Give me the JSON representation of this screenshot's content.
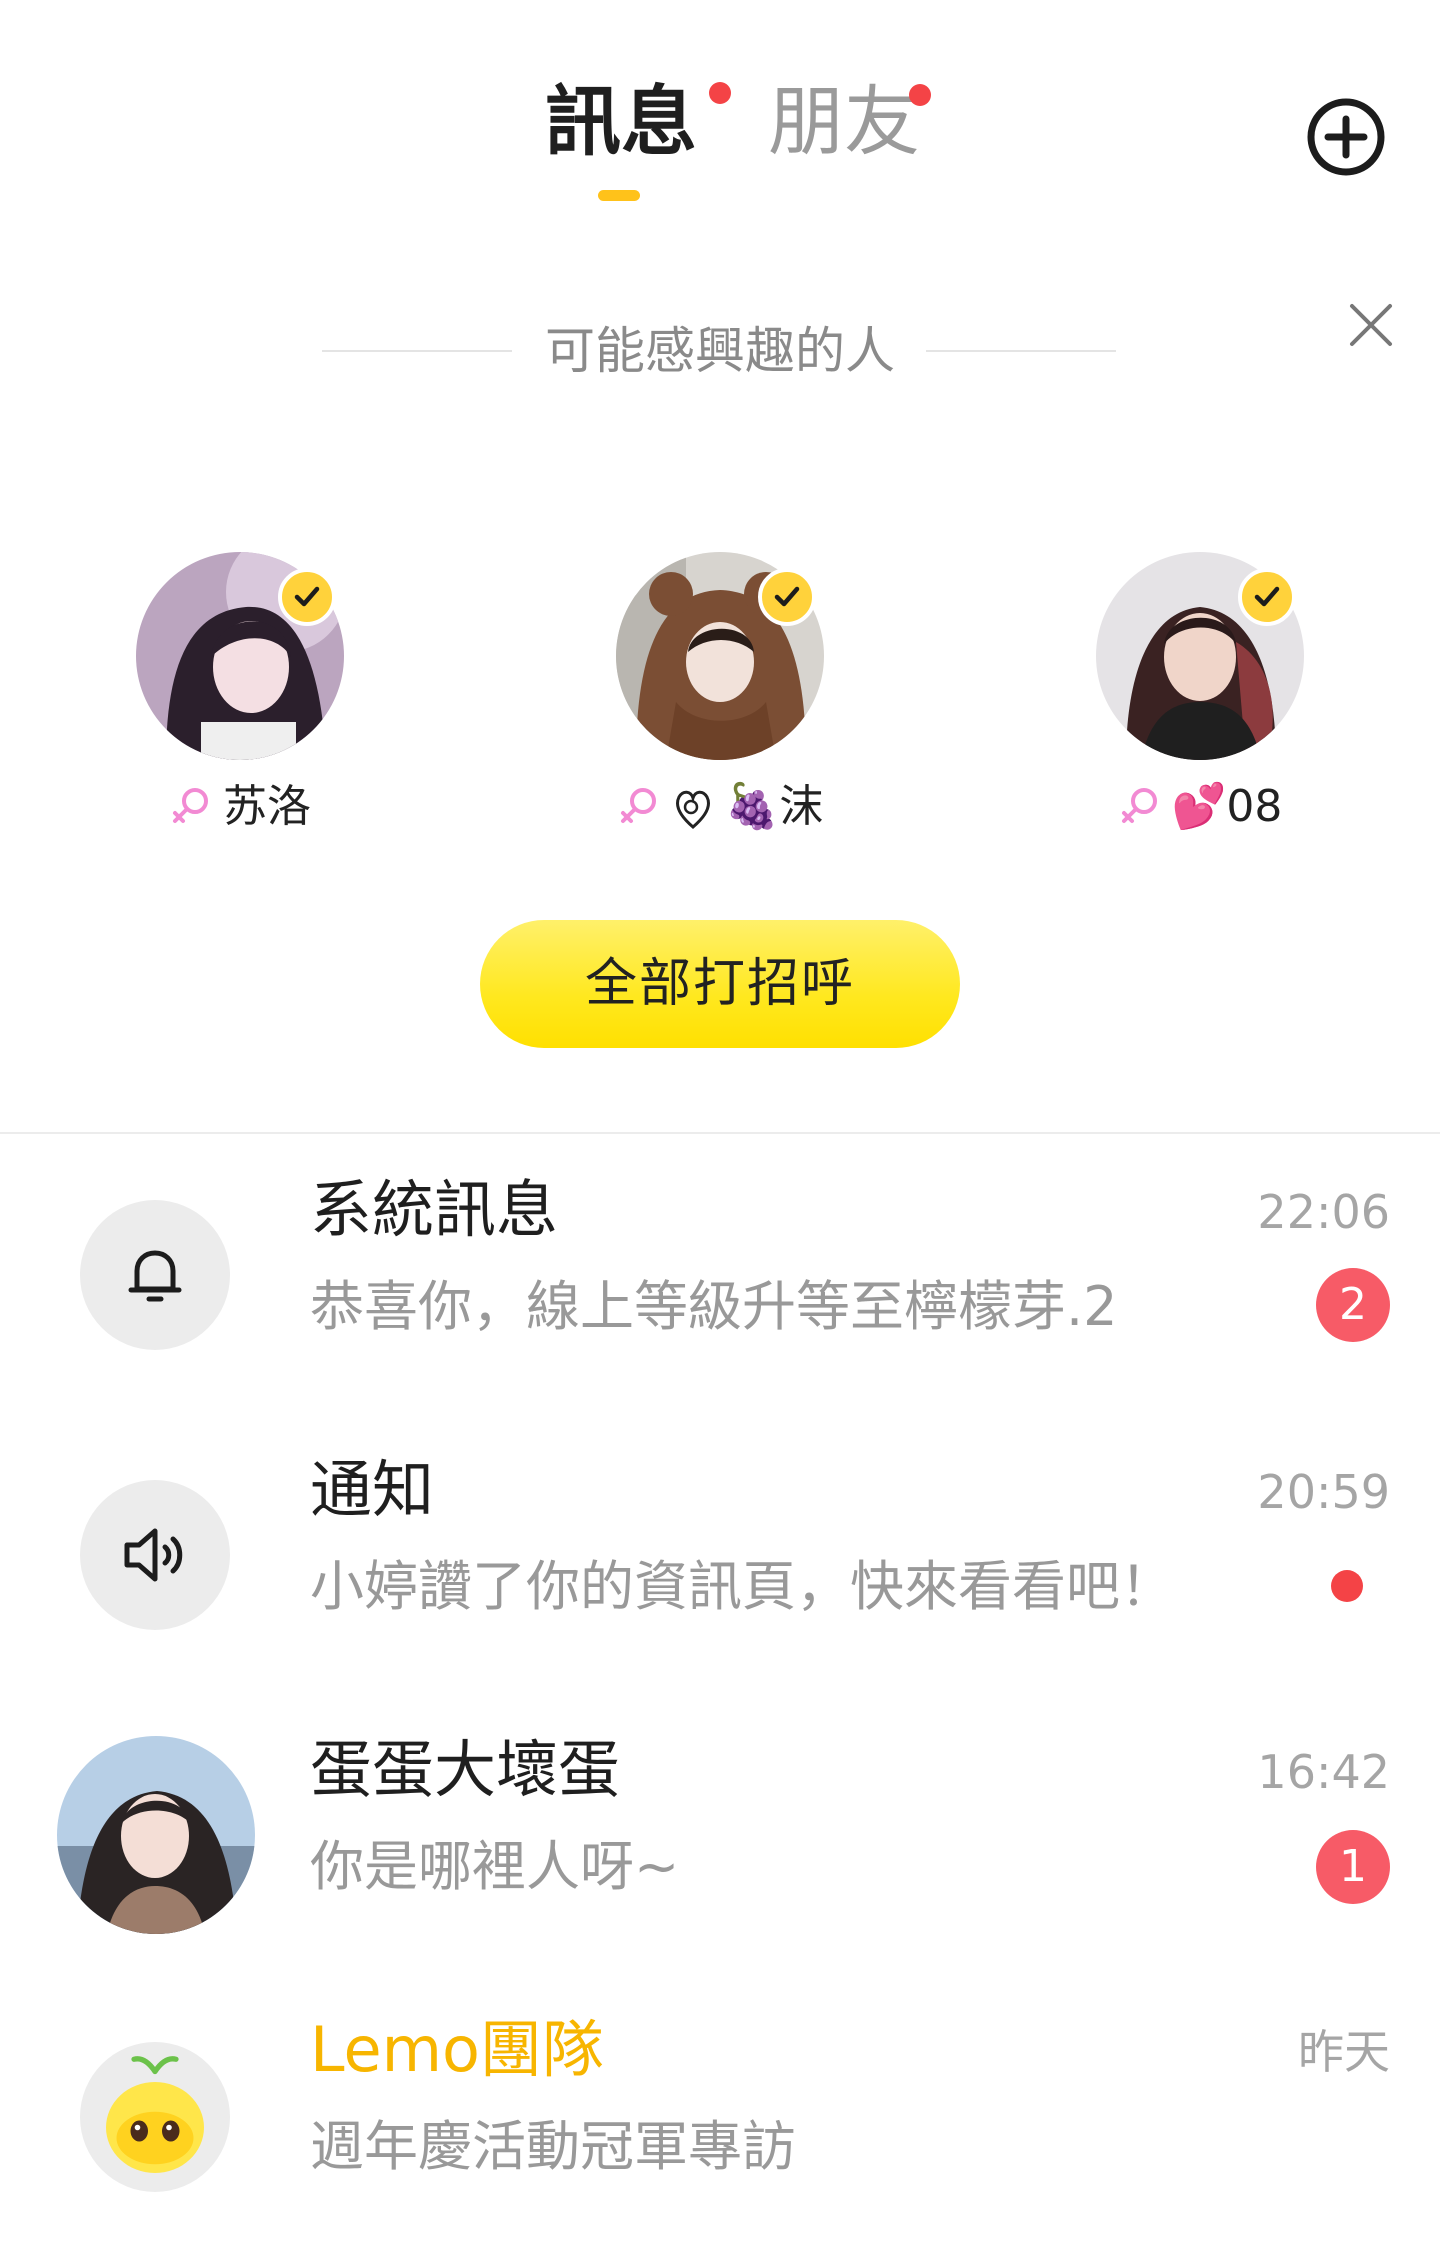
{
  "header": {
    "tabs": [
      {
        "label": "訊息",
        "active": true,
        "has_dot": true
      },
      {
        "label": "朋友",
        "active": false,
        "has_dot": true
      }
    ],
    "add_icon": "plus-circle-icon",
    "accent_color": "#ffc21a",
    "dot_color": "#f44346"
  },
  "suggestions": {
    "title": "可能感興趣的人",
    "close_icon": "close-icon",
    "people": [
      {
        "name": "苏洛",
        "gender_icon": "female-icon",
        "verified": true
      },
      {
        "name": "🍇沫",
        "gender_icon": "female-icon",
        "verified": true
      },
      {
        "name": "💕08",
        "gender_icon": "female-icon",
        "verified": true
      }
    ],
    "greet_all_label": "全部打招呼"
  },
  "conversations": [
    {
      "title": "系統訊息",
      "preview": "恭喜你，線上等級升等至檸檬芽.2",
      "time": "22:06",
      "badge": "2",
      "icon": "bell-icon"
    },
    {
      "title": "通知",
      "preview": "小婷讚了你的資訊頁，快來看看吧！",
      "time": "20:59",
      "unread_dot": true,
      "icon": "speaker-icon"
    },
    {
      "title": "蛋蛋大壞蛋",
      "preview": "你是哪裡人呀~",
      "time": "16:42",
      "badge": "1"
    },
    {
      "title": "Lemo團隊",
      "preview": "週年慶活動冠軍專訪",
      "time": "昨天",
      "title_color": "#f7b500"
    }
  ]
}
